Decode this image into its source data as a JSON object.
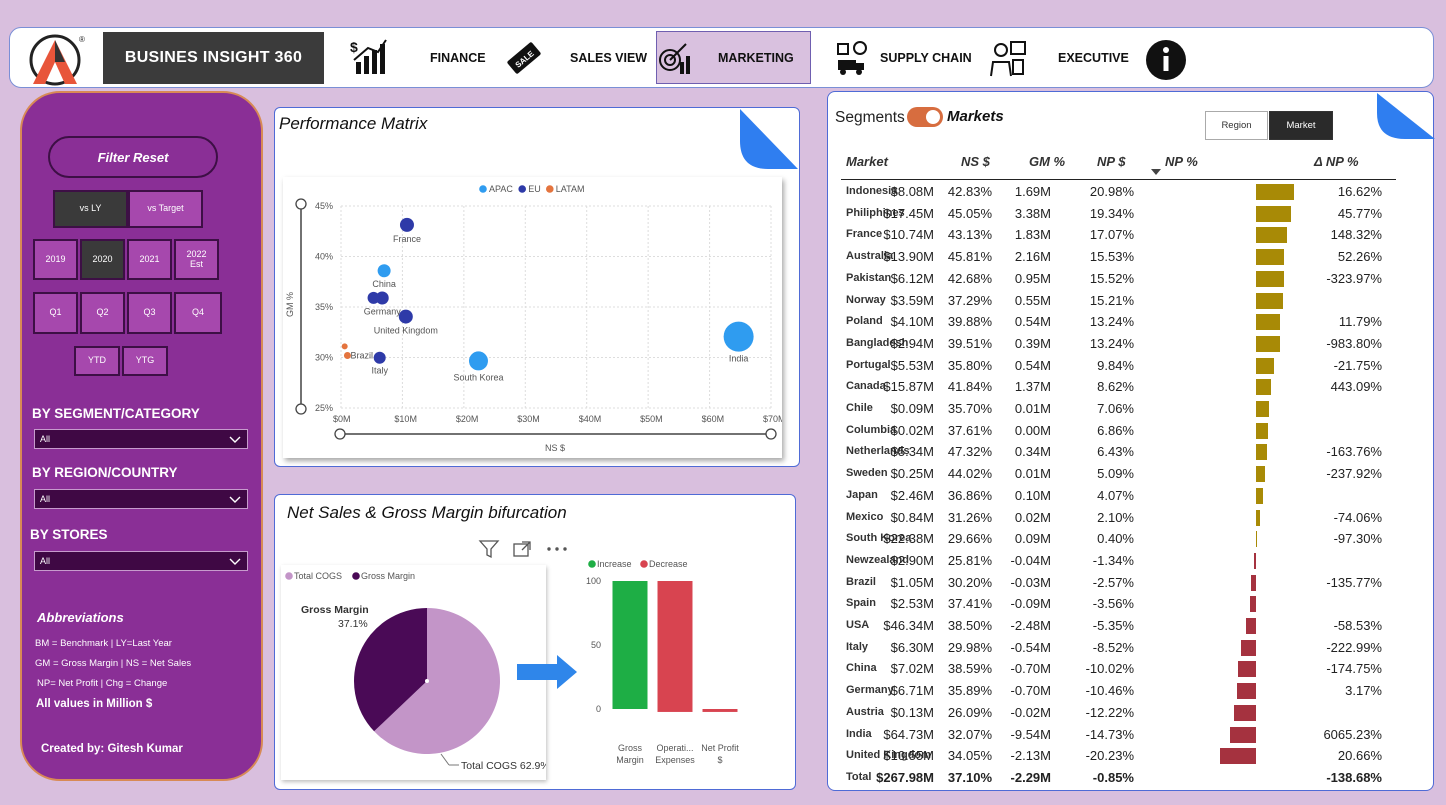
{
  "app": {
    "title": "BUSINES INSIGHT 360"
  },
  "nav": {
    "finance": "FINANCE",
    "sales": "SALES VIEW",
    "marketing": "MARKETING",
    "supply": "SUPPLY CHAIN",
    "executive": "EXECUTIVE"
  },
  "filters": {
    "reset": "Filter Reset",
    "compare": [
      "vs LY",
      "vs Target"
    ],
    "years": [
      "2019",
      "2020",
      "2021",
      "2022 Est"
    ],
    "quarters": [
      "Q1",
      "Q2",
      "Q3",
      "Q4"
    ],
    "periods": [
      "YTD",
      "YTG"
    ],
    "segment_heading": "BY SEGMENT/CATEGORY",
    "segment_value": "All",
    "region_heading": "BY REGION/COUNTRY",
    "region_value": "All",
    "stores_heading": "BY STORES",
    "stores_value": "All"
  },
  "abbreviations": {
    "title": "Abbreviations",
    "line1": "BM = Benchmark | LY=Last Year",
    "line2": "GM = Gross Margin | NS = Net Sales",
    "line3": "NP= Net Profit | Chg = Change",
    "note": "All values in Million $",
    "credit": "Created by: Gitesh Kumar"
  },
  "colors": {
    "apac": "#2f9cf0",
    "eu": "#2e3aa8",
    "latam": "#e4743e",
    "cogs": "#c395c8",
    "gross_margin": "#4a0a56",
    "increase": "#1eae45",
    "decrease": "#d84450",
    "np_pos": "#a88a06",
    "np_neg": "#a5323f"
  },
  "performance_matrix": {
    "title": "Performance Matrix",
    "chart_data": {
      "type": "scatter",
      "xlabel": "NS $",
      "ylabel": "GM %",
      "xlim": [
        0,
        70
      ],
      "ylim": [
        25,
        45
      ],
      "x_ticks": [
        "$0M",
        "$10M",
        "$20M",
        "$30M",
        "$40M",
        "$50M",
        "$60M",
        "$70M"
      ],
      "y_ticks": [
        "45%",
        "40%",
        "35%",
        "30%",
        "25%"
      ],
      "legend": [
        "APAC",
        "EU",
        "LATAM"
      ],
      "points": [
        {
          "label": "France",
          "x": 10.74,
          "y": 43.13,
          "region": "EU",
          "r": 7
        },
        {
          "label": "China",
          "x": 7.02,
          "y": 38.59,
          "region": "APAC",
          "r": 6.5
        },
        {
          "label": "",
          "x": 5.3,
          "y": 35.9,
          "region": "EU",
          "r": 6
        },
        {
          "label": "Germany",
          "x": 6.71,
          "y": 35.89,
          "region": "EU",
          "r": 6.5
        },
        {
          "label": "United Kingdom",
          "x": 10.55,
          "y": 34.05,
          "region": "EU",
          "r": 7
        },
        {
          "label": "",
          "x": 0.6,
          "y": 31.1,
          "region": "LATAM",
          "r": 3
        },
        {
          "label": "Brazil",
          "x": 1.05,
          "y": 30.2,
          "region": "LATAM",
          "r": 3.5
        },
        {
          "label": "Italy",
          "x": 6.3,
          "y": 29.98,
          "region": "EU",
          "r": 6
        },
        {
          "label": "South Korea",
          "x": 22.38,
          "y": 29.66,
          "region": "APAC",
          "r": 9.5
        },
        {
          "label": "India",
          "x": 64.73,
          "y": 32.07,
          "region": "APAC",
          "r": 15
        }
      ]
    }
  },
  "bifurcation": {
    "title": "Net Sales & Gross Margin bifurcation",
    "pie": {
      "chart_data": {
        "type": "pie",
        "legend": [
          "Total COGS",
          "Gross Margin"
        ],
        "slices": [
          {
            "name": "Total COGS",
            "value": 62.9,
            "label": "Total COGS 62.9%"
          },
          {
            "name": "Gross Margin",
            "value": 37.1,
            "label_name": "Gross Margin",
            "label_pct": "37.1%"
          }
        ]
      }
    },
    "waterfall": {
      "chart_data": {
        "type": "bar",
        "legend": [
          "Increase",
          "Decrease"
        ],
        "ylim": [
          0,
          100
        ],
        "y_ticks": [
          "100",
          "50",
          "0"
        ],
        "categories": [
          "Gross Margin",
          "Operati... Expenses",
          "Net Profit $"
        ],
        "bars": [
          {
            "category": "Gross Margin",
            "start": 0,
            "end": 100,
            "kind": "increase"
          },
          {
            "category": "Operati... Expenses",
            "start": 100,
            "end": -2.3,
            "kind": "decrease"
          },
          {
            "category": "Net Profit $",
            "start": 0,
            "end": -2.3,
            "kind": "decrease"
          }
        ]
      }
    }
  },
  "markets_table": {
    "segments_label": "Segments",
    "markets_label": "Markets",
    "region_btn": "Region",
    "market_btn": "Market",
    "headers": [
      "Market",
      "NS $",
      "GM %",
      "NP $",
      "NP %",
      "Δ NP %"
    ],
    "rows": [
      {
        "market": "Indonesia",
        "ns": "$8.08M",
        "gm": "42.83%",
        "np": "1.69M",
        "npp": "20.98%",
        "npv": 20.98,
        "chg": "16.62%"
      },
      {
        "market": "Philiphines",
        "ns": "$17.45M",
        "gm": "45.05%",
        "np": "3.38M",
        "npp": "19.34%",
        "npv": 19.34,
        "chg": "45.77%"
      },
      {
        "market": "France",
        "ns": "$10.74M",
        "gm": "43.13%",
        "np": "1.83M",
        "npp": "17.07%",
        "npv": 17.07,
        "chg": "148.32%"
      },
      {
        "market": "Australia",
        "ns": "$13.90M",
        "gm": "45.81%",
        "np": "2.16M",
        "npp": "15.53%",
        "npv": 15.53,
        "chg": "52.26%"
      },
      {
        "market": "Pakistan",
        "ns": "$6.12M",
        "gm": "42.68%",
        "np": "0.95M",
        "npp": "15.52%",
        "npv": 15.52,
        "chg": "-323.97%"
      },
      {
        "market": "Norway",
        "ns": "$3.59M",
        "gm": "37.29%",
        "np": "0.55M",
        "npp": "15.21%",
        "npv": 15.21,
        "chg": ""
      },
      {
        "market": "Poland",
        "ns": "$4.10M",
        "gm": "39.88%",
        "np": "0.54M",
        "npp": "13.24%",
        "npv": 13.24,
        "chg": "11.79%"
      },
      {
        "market": "Bangladesh",
        "ns": "$2.94M",
        "gm": "39.51%",
        "np": "0.39M",
        "npp": "13.24%",
        "npv": 13.24,
        "chg": "-983.80%"
      },
      {
        "market": "Portugal",
        "ns": "$5.53M",
        "gm": "35.80%",
        "np": "0.54M",
        "npp": "9.84%",
        "npv": 9.84,
        "chg": "-21.75%"
      },
      {
        "market": "Canada",
        "ns": "$15.87M",
        "gm": "41.84%",
        "np": "1.37M",
        "npp": "8.62%",
        "npv": 8.62,
        "chg": "443.09%"
      },
      {
        "market": "Chile",
        "ns": "$0.09M",
        "gm": "35.70%",
        "np": "0.01M",
        "npp": "7.06%",
        "npv": 7.06,
        "chg": ""
      },
      {
        "market": "Columbia",
        "ns": "$0.02M",
        "gm": "37.61%",
        "np": "0.00M",
        "npp": "6.86%",
        "npv": 6.86,
        "chg": ""
      },
      {
        "market": "Netherlands",
        "ns": "$5.34M",
        "gm": "47.32%",
        "np": "0.34M",
        "npp": "6.43%",
        "npv": 6.43,
        "chg": "-163.76%"
      },
      {
        "market": "Sweden",
        "ns": "$0.25M",
        "gm": "44.02%",
        "np": "0.01M",
        "npp": "5.09%",
        "npv": 5.09,
        "chg": "-237.92%"
      },
      {
        "market": "Japan",
        "ns": "$2.46M",
        "gm": "36.86%",
        "np": "0.10M",
        "npp": "4.07%",
        "npv": 4.07,
        "chg": ""
      },
      {
        "market": "Mexico",
        "ns": "$0.84M",
        "gm": "31.26%",
        "np": "0.02M",
        "npp": "2.10%",
        "npv": 2.1,
        "chg": "-74.06%"
      },
      {
        "market": "South Korea",
        "ns": "$22.38M",
        "gm": "29.66%",
        "np": "0.09M",
        "npp": "0.40%",
        "npv": 0.4,
        "chg": "-97.30%"
      },
      {
        "market": "Newzealand",
        "ns": "$2.90M",
        "gm": "25.81%",
        "np": "-0.04M",
        "npp": "-1.34%",
        "npv": -1.34,
        "chg": ""
      },
      {
        "market": "Brazil",
        "ns": "$1.05M",
        "gm": "30.20%",
        "np": "-0.03M",
        "npp": "-2.57%",
        "npv": -2.57,
        "chg": "-135.77%"
      },
      {
        "market": "Spain",
        "ns": "$2.53M",
        "gm": "37.41%",
        "np": "-0.09M",
        "npp": "-3.56%",
        "npv": -3.56,
        "chg": ""
      },
      {
        "market": "USA",
        "ns": "$46.34M",
        "gm": "38.50%",
        "np": "-2.48M",
        "npp": "-5.35%",
        "npv": -5.35,
        "chg": "-58.53%"
      },
      {
        "market": "Italy",
        "ns": "$6.30M",
        "gm": "29.98%",
        "np": "-0.54M",
        "npp": "-8.52%",
        "npv": -8.52,
        "chg": "-222.99%"
      },
      {
        "market": "China",
        "ns": "$7.02M",
        "gm": "38.59%",
        "np": "-0.70M",
        "npp": "-10.02%",
        "npv": -10.02,
        "chg": "-174.75%"
      },
      {
        "market": "Germany",
        "ns": "$6.71M",
        "gm": "35.89%",
        "np": "-0.70M",
        "npp": "-10.46%",
        "npv": -10.46,
        "chg": "3.17%"
      },
      {
        "market": "Austria",
        "ns": "$0.13M",
        "gm": "26.09%",
        "np": "-0.02M",
        "npp": "-12.22%",
        "npv": -12.22,
        "chg": ""
      },
      {
        "market": "India",
        "ns": "$64.73M",
        "gm": "32.07%",
        "np": "-9.54M",
        "npp": "-14.73%",
        "npv": -14.73,
        "chg": "6065.23%"
      },
      {
        "market": "United Kingdom",
        "ns": "$10.55M",
        "gm": "34.05%",
        "np": "-2.13M",
        "npp": "-20.23%",
        "npv": -20.23,
        "chg": "20.66%"
      }
    ],
    "total": {
      "market": "Total",
      "ns": "$267.98M",
      "gm": "37.10%",
      "np": "-2.29M",
      "npp": "-0.85%",
      "chg": "-138.68%"
    }
  }
}
